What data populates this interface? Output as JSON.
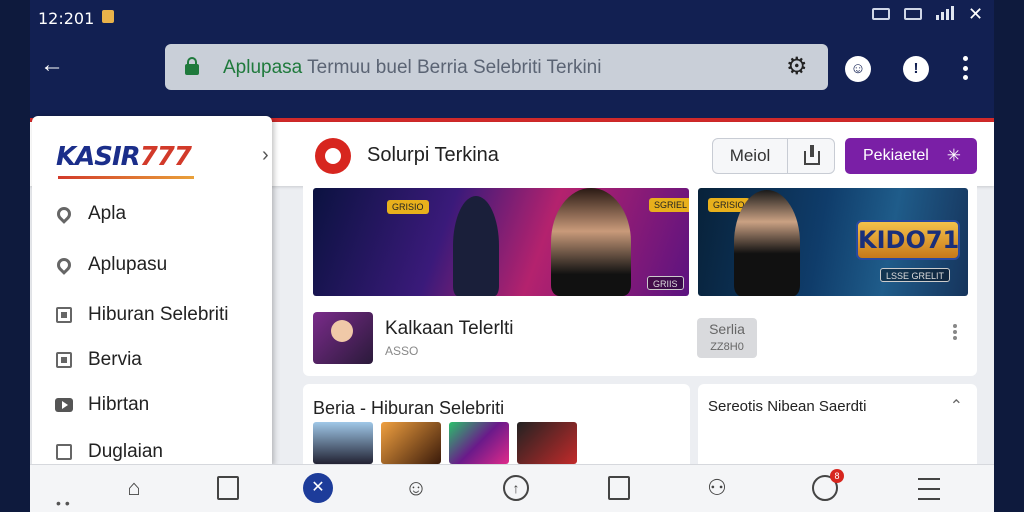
{
  "status": {
    "time": "12:201"
  },
  "browser": {
    "url_scheme": "Aplupasa",
    "url_rest": " Termuu buel Berria Selebriti Terkini"
  },
  "sidebar": {
    "brand_main": "KASIR",
    "brand_num": "777",
    "items": [
      {
        "label": "Apla",
        "icon": "location-pin-icon"
      },
      {
        "label": "Aplupasu",
        "icon": "location-pin-icon"
      },
      {
        "label": "Hiburan Selebriti",
        "icon": "chart-box-icon"
      },
      {
        "label": "Bervia",
        "icon": "square-icon"
      },
      {
        "label": "Hibrtan",
        "icon": "play-icon"
      },
      {
        "label": "Duglaian",
        "icon": "camera-icon"
      }
    ]
  },
  "header": {
    "title": "Solurpi Terkina",
    "meiol_label": "Meiol",
    "purple_label": "Pekiaetel"
  },
  "banners": {
    "b1_tag_left": "GRISIO",
    "b1_tag_right": "SGRIEL",
    "b1_tag_bottom": "GRIIS",
    "b2_tag": "GRISIO",
    "b2_logo": "KIDO71",
    "b2_caption": "LSSE GRELIT"
  },
  "row": {
    "title": "Kalkaan Telerlti",
    "sub": "ASSO",
    "pill_top": "Serlia",
    "pill_bottom": "ZZ8H0"
  },
  "cards": {
    "c2_title": "Beria - Hiburan Selebriti",
    "c3_title": "Sereotis Nibean Saerdti"
  },
  "colors": {
    "frame": "#122052",
    "accent_red": "#d12a2a",
    "purple": "#7a1fa6",
    "active_nav": "#1d3c9a"
  }
}
